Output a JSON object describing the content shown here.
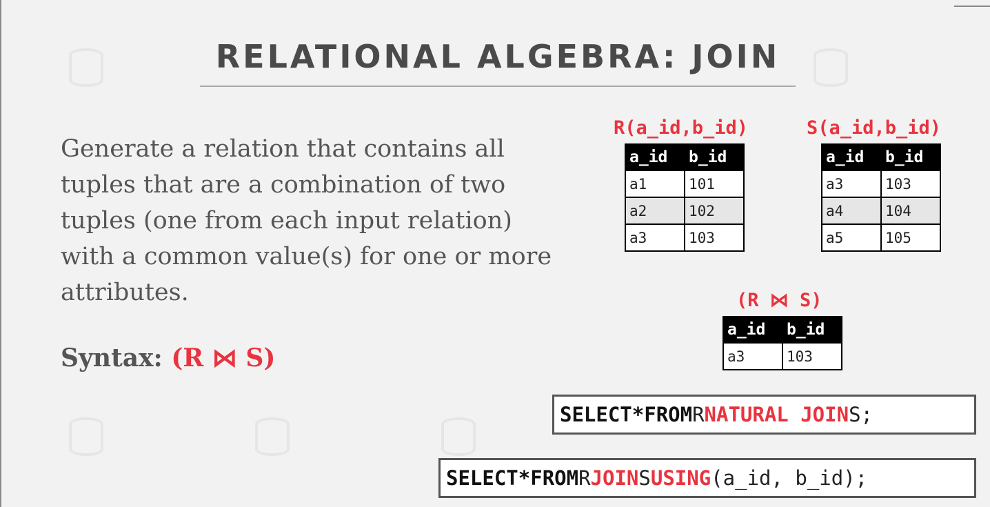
{
  "slide": {
    "title": "RELATIONAL ALGEBRA: JOIN",
    "description": "Generate a relation that contains all tuples that are a combination of two tuples (one from each input relation) with a common value(s) for one or more attributes.",
    "syntax_label": "Syntax:",
    "syntax_expr": "(R ⋈ S)"
  },
  "relations": {
    "r": {
      "label": "R(a_id,b_id)",
      "headers": [
        "a_id",
        "b_id"
      ],
      "rows": [
        [
          "a1",
          "101"
        ],
        [
          "a2",
          "102"
        ],
        [
          "a3",
          "103"
        ]
      ]
    },
    "s": {
      "label": "S(a_id,b_id)",
      "headers": [
        "a_id",
        "b_id"
      ],
      "rows": [
        [
          "a3",
          "103"
        ],
        [
          "a4",
          "104"
        ],
        [
          "a5",
          "105"
        ]
      ]
    },
    "join": {
      "label": "(R ⋈ S)",
      "headers": [
        "a_id",
        "b_id"
      ],
      "rows": [
        [
          "a3",
          "103"
        ]
      ]
    }
  },
  "sql": {
    "natural": {
      "select": "SELECT",
      "star": "*",
      "from": "FROM",
      "left": "R",
      "join_kw": "NATURAL JOIN",
      "right": "S;"
    },
    "using": {
      "select": "SELECT",
      "star": "*",
      "from": "FROM",
      "left": "R",
      "join_kw": "JOIN",
      "right": "S",
      "using_kw": "USING",
      "cols": "(a_id, b_id);"
    }
  },
  "colors": {
    "accent": "#e8343f",
    "title": "#4a4a4a",
    "body_text": "#555555"
  }
}
